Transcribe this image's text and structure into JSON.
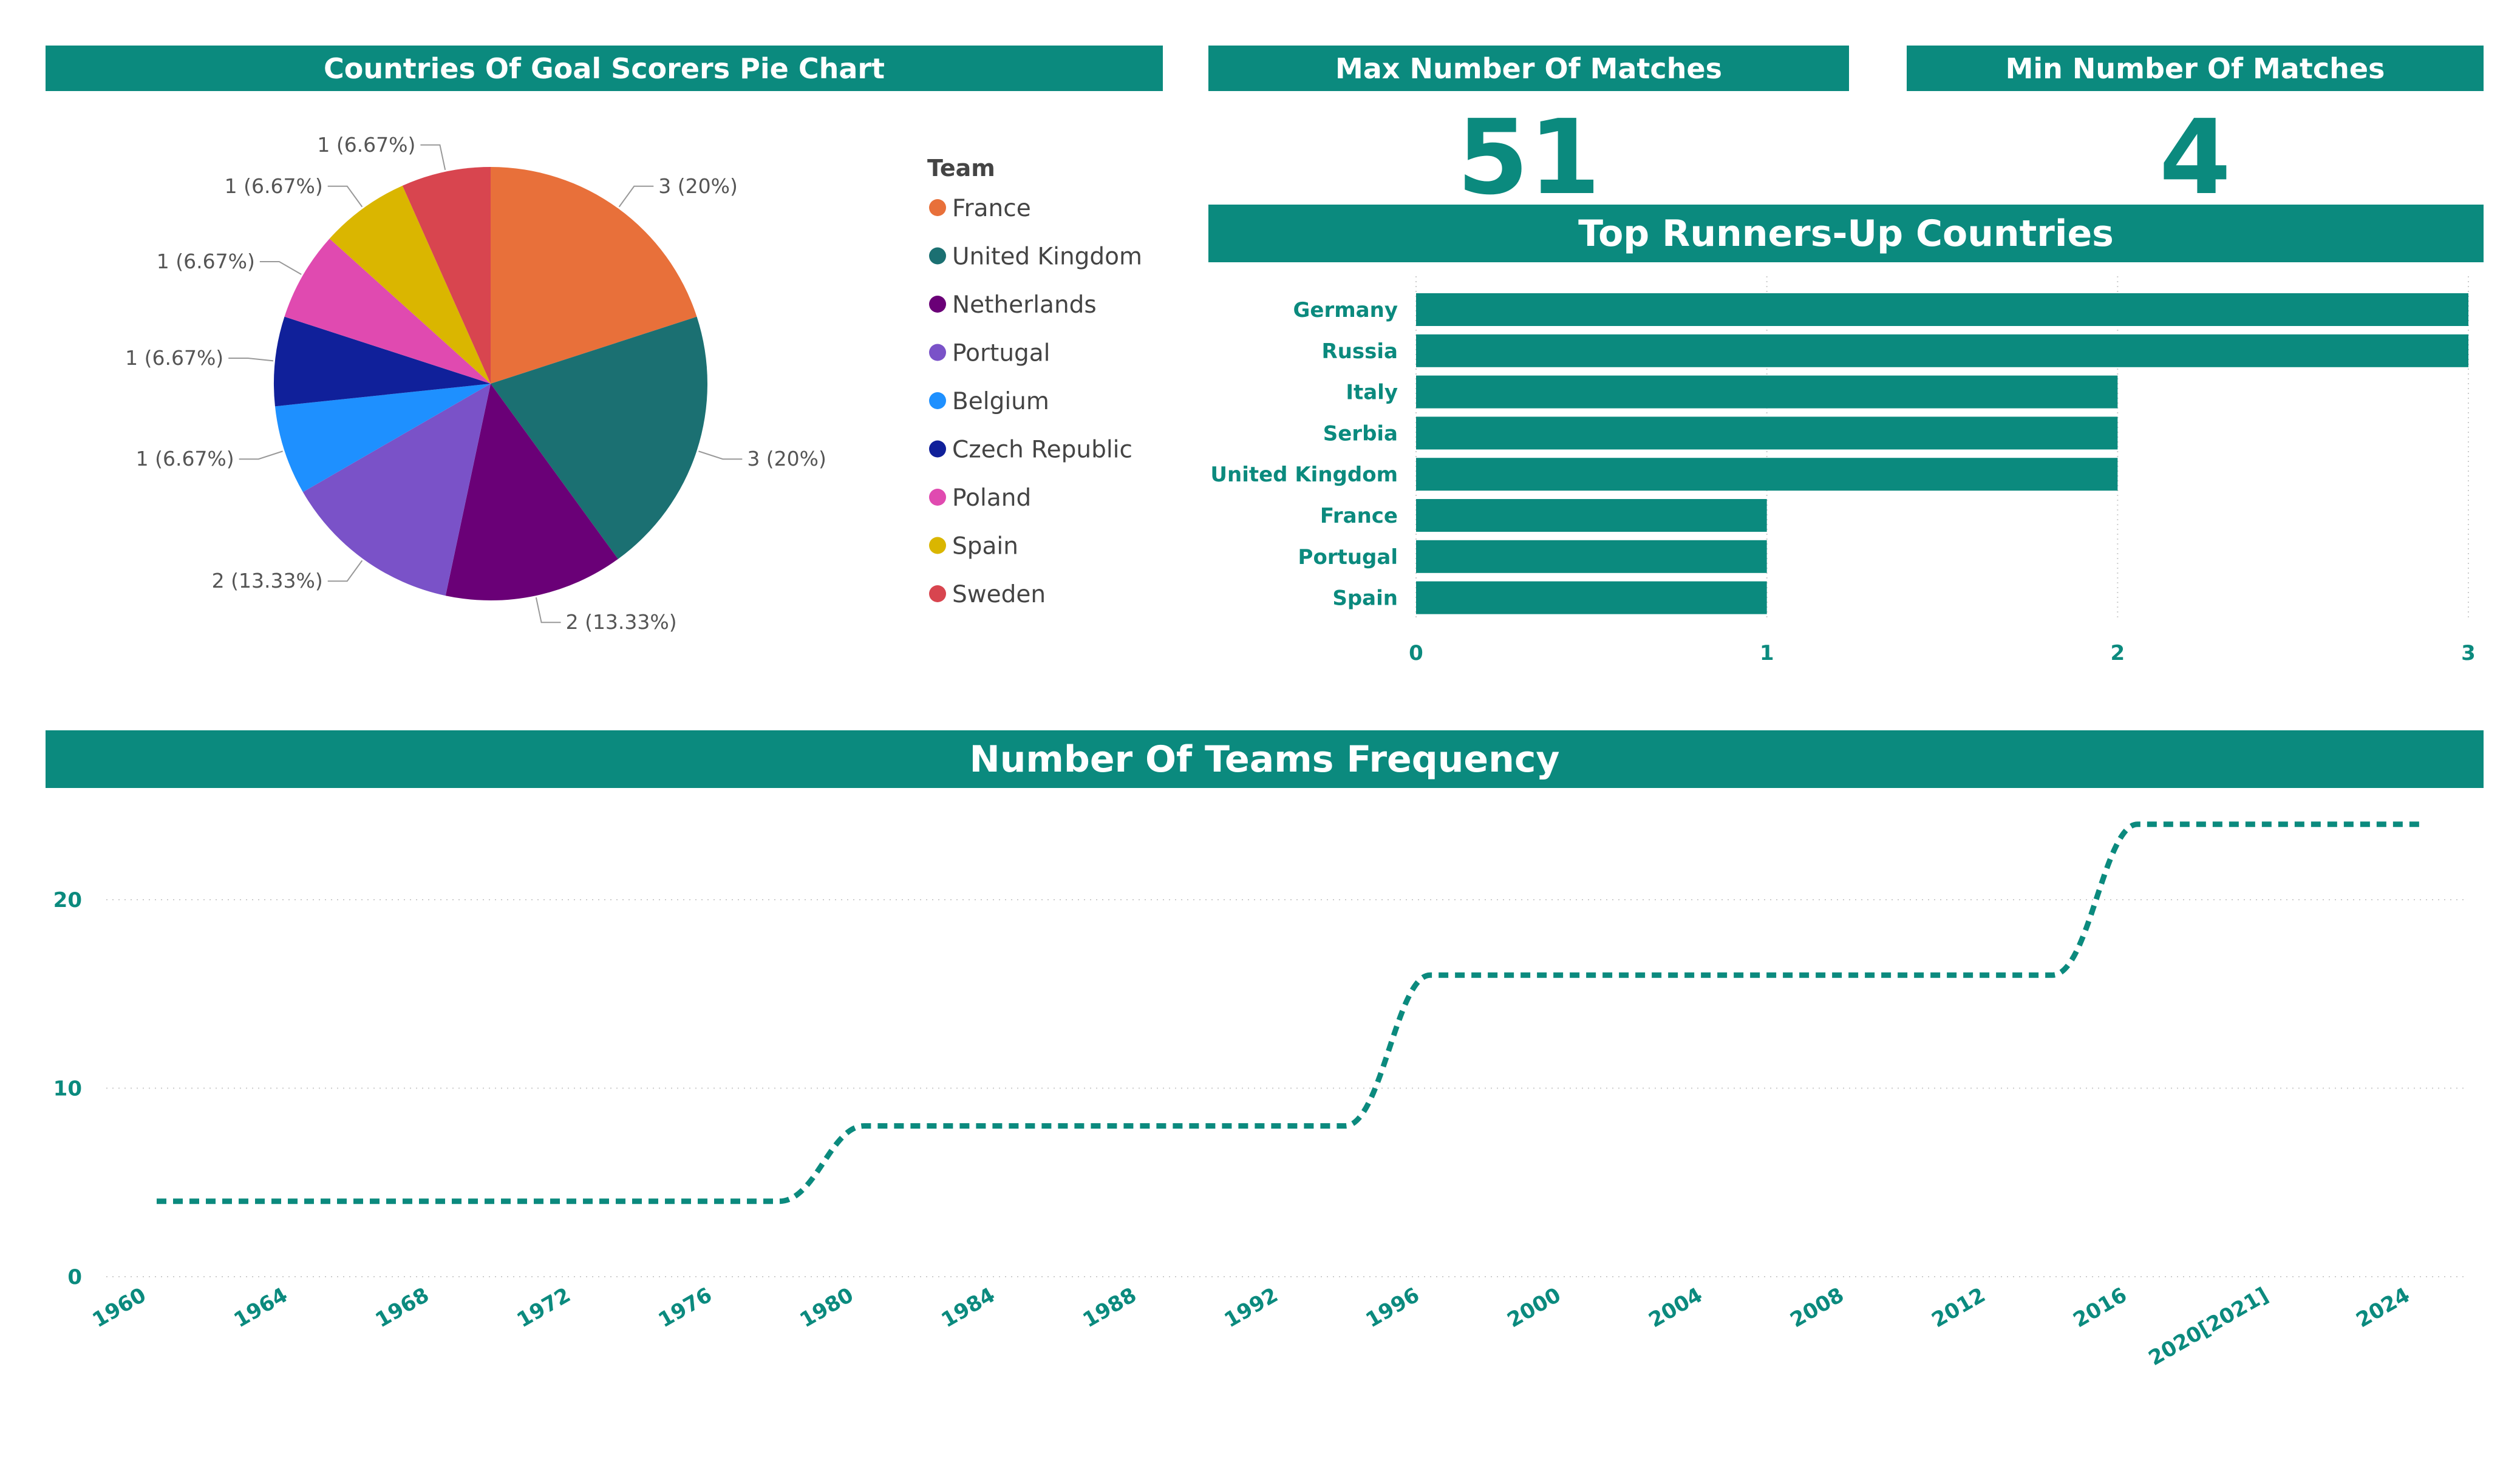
{
  "headers": {
    "pie": "Countries Of Goal Scorers Pie Chart",
    "max": "Max Number Of Matches",
    "min": "Min Number Of Matches",
    "bar": "Top Runners-Up Countries",
    "line": "Number Of Teams Frequency"
  },
  "kpis": {
    "max_value": "51",
    "min_value": "4"
  },
  "colors": {
    "accent": "#0b8a7e",
    "slices": [
      "#e8703a",
      "#1b7072",
      "#6a0077",
      "#7a52c8",
      "#1e90ff",
      "#10209a",
      "#e04ab0",
      "#dab600",
      "#d8454f"
    ]
  },
  "chart_data": [
    {
      "type": "pie",
      "legend_title": "Team",
      "legend_position": "right",
      "labels": [
        "France",
        "United Kingdom",
        "Netherlands",
        "Portugal",
        "Belgium",
        "Czech Republic",
        "Poland",
        "Spain",
        "Sweden"
      ],
      "values": [
        3,
        3,
        2,
        2,
        1,
        1,
        1,
        1,
        1
      ],
      "data_labels": [
        "3 (20%)",
        "3 (20%)",
        "2 (13.33%)",
        "2 (13.33%)",
        "1 (6.67%)",
        "1 (6.67%)",
        "1 (6.67%)",
        "1 (6.67%)",
        "1 (6.67%)"
      ]
    },
    {
      "type": "bar",
      "orientation": "horizontal",
      "categories": [
        "Germany",
        "Russia",
        "Italy",
        "Serbia",
        "United Kingdom",
        "France",
        "Portugal",
        "Spain"
      ],
      "values": [
        3,
        3,
        2,
        2,
        2,
        1,
        1,
        1
      ],
      "xlim": [
        0,
        3
      ],
      "xticks": [
        "0",
        "1",
        "2",
        "3"
      ],
      "grid": true
    },
    {
      "type": "line",
      "line_style": "dashed",
      "x": [
        "1960",
        "1964",
        "1968",
        "1972",
        "1976",
        "1980",
        "1984",
        "1988",
        "1992",
        "1996",
        "2000",
        "2004",
        "2008",
        "2012",
        "2016",
        "2020[2021]",
        "2024"
      ],
      "values": [
        4,
        4,
        4,
        4,
        4,
        8,
        8,
        8,
        8,
        16,
        16,
        16,
        16,
        16,
        24,
        24,
        24
      ],
      "ylim": [
        0,
        24
      ],
      "yticks": [
        "0",
        "10",
        "20"
      ],
      "grid": true
    }
  ]
}
